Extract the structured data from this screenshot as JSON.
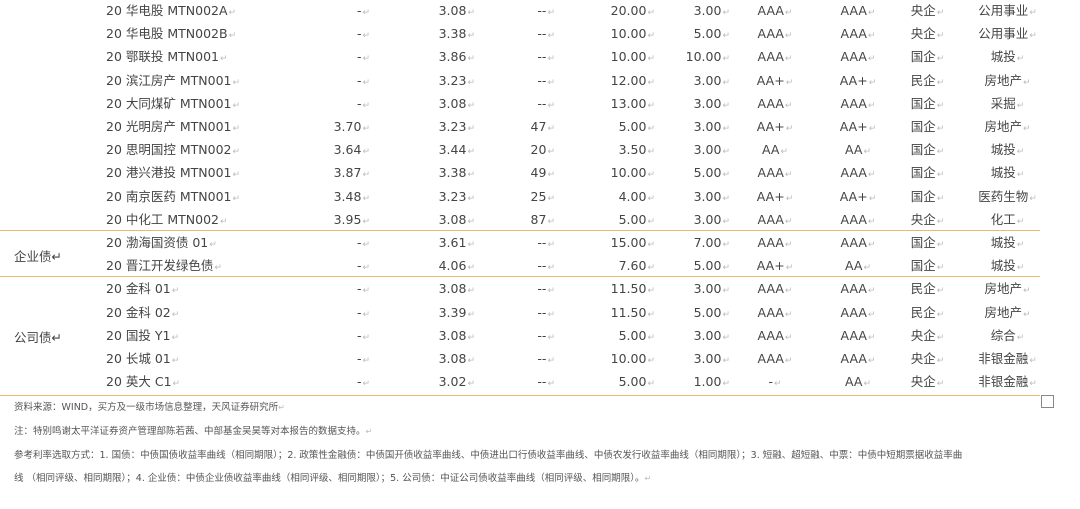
{
  "mark": "↵",
  "groups": [
    {
      "label": "",
      "rows": [
        {
          "name": "20 华电股 MTN002A",
          "v1": "-",
          "v2": "3.08",
          "v3": "--",
          "v4": "20.00",
          "v5": "3.00",
          "v6": "AAA",
          "v7": "AAA",
          "v8": "央企",
          "v9": "公用事业"
        },
        {
          "name": "20 华电股 MTN002B",
          "v1": "-",
          "v2": "3.38",
          "v3": "--",
          "v4": "10.00",
          "v5": "5.00",
          "v6": "AAA",
          "v7": "AAA",
          "v8": "央企",
          "v9": "公用事业"
        },
        {
          "name": "20 鄂联投 MTN001",
          "v1": "-",
          "v2": "3.86",
          "v3": "--",
          "v4": "10.00",
          "v5": "10.00",
          "v6": "AAA",
          "v7": "AAA",
          "v8": "国企",
          "v9": "城投"
        },
        {
          "name": "20 滨江房产 MTN001",
          "v1": "-",
          "v2": "3.23",
          "v3": "--",
          "v4": "12.00",
          "v5": "3.00",
          "v6": "AA+",
          "v7": "AA+",
          "v8": "民企",
          "v9": "房地产"
        },
        {
          "name": "20 大同煤矿 MTN001",
          "v1": "-",
          "v2": "3.08",
          "v3": "--",
          "v4": "13.00",
          "v5": "3.00",
          "v6": "AAA",
          "v7": "AAA",
          "v8": "国企",
          "v9": "采掘"
        },
        {
          "name": "20 光明房产 MTN001",
          "v1": "3.70",
          "v2": "3.23",
          "v3": "47",
          "v4": "5.00",
          "v5": "3.00",
          "v6": "AA+",
          "v7": "AA+",
          "v8": "国企",
          "v9": "房地产"
        },
        {
          "name": "20 思明国控 MTN002",
          "v1": "3.64",
          "v2": "3.44",
          "v3": "20",
          "v4": "3.50",
          "v5": "3.00",
          "v6": "AA",
          "v7": "AA",
          "v8": "国企",
          "v9": "城投"
        },
        {
          "name": "20 港兴港投 MTN001",
          "v1": "3.87",
          "v2": "3.38",
          "v3": "49",
          "v4": "10.00",
          "v5": "5.00",
          "v6": "AAA",
          "v7": "AAA",
          "v8": "国企",
          "v9": "城投"
        },
        {
          "name": "20 南京医药 MTN001",
          "v1": "3.48",
          "v2": "3.23",
          "v3": "25",
          "v4": "4.00",
          "v5": "3.00",
          "v6": "AA+",
          "v7": "AA+",
          "v8": "国企",
          "v9": "医药生物"
        },
        {
          "name": "20 中化工 MTN002",
          "v1": "3.95",
          "v2": "3.08",
          "v3": "87",
          "v4": "5.00",
          "v5": "3.00",
          "v6": "AAA",
          "v7": "AAA",
          "v8": "央企",
          "v9": "化工"
        }
      ]
    },
    {
      "label": "企业债",
      "rows": [
        {
          "name": "20 渤海国资债 01",
          "v1": "-",
          "v2": "3.61",
          "v3": "--",
          "v4": "15.00",
          "v5": "7.00",
          "v6": "AAA",
          "v7": "AAA",
          "v8": "国企",
          "v9": "城投"
        },
        {
          "name": "20 晋江开发绿色债",
          "v1": "-",
          "v2": "4.06",
          "v3": "--",
          "v4": "7.60",
          "v5": "5.00",
          "v6": "AA+",
          "v7": "AA",
          "v8": "国企",
          "v9": "城投"
        }
      ]
    },
    {
      "label": "公司债",
      "rows": [
        {
          "name": "20 金科 01",
          "v1": "-",
          "v2": "3.08",
          "v3": "--",
          "v4": "11.50",
          "v5": "3.00",
          "v6": "AAA",
          "v7": "AAA",
          "v8": "民企",
          "v9": "房地产"
        },
        {
          "name": "20 金科 02",
          "v1": "-",
          "v2": "3.39",
          "v3": "--",
          "v4": "11.50",
          "v5": "5.00",
          "v6": "AAA",
          "v7": "AAA",
          "v8": "民企",
          "v9": "房地产"
        },
        {
          "name": "20 国投 Y1",
          "v1": "-",
          "v2": "3.08",
          "v3": "--",
          "v4": "5.00",
          "v5": "3.00",
          "v6": "AAA",
          "v7": "AAA",
          "v8": "央企",
          "v9": "综合"
        },
        {
          "name": "20 长城 01",
          "v1": "-",
          "v2": "3.08",
          "v3": "--",
          "v4": "10.00",
          "v5": "3.00",
          "v6": "AAA",
          "v7": "AAA",
          "v8": "央企",
          "v9": "非银金融"
        },
        {
          "name": "20 英大 C1",
          "v1": "-",
          "v2": "3.02",
          "v3": "--",
          "v4": "5.00",
          "v5": "1.00",
          "v6": "-",
          "v7": "AA",
          "v8": "央企",
          "v9": "非银金融"
        }
      ]
    }
  ],
  "notes": {
    "source": "资料来源：WIND，买方及一级市场信息整理，天风证券研究所",
    "thanks": "注：特别鸣谢太平洋证券资产管理部陈若茜、中部基金吴昊等对本报告的数据支持。",
    "method_1": "参考利率选取方式：1. 国债：中债国债收益率曲线（相同期限）；2. 政策性金融债：中债国开债收益率曲线、中债进出口行债收益率曲线、中债农发行收益率曲线（相同期限）；3. 短融、超短融、中票：中债中短期票据收益率曲",
    "method_2": "线 （相同评级、相同期限）；4. 企业债：中债企业债收益率曲线（相同评级、相同期限）；5. 公司债：中证公司债收益率曲线（相同评级、相同期限）。"
  }
}
